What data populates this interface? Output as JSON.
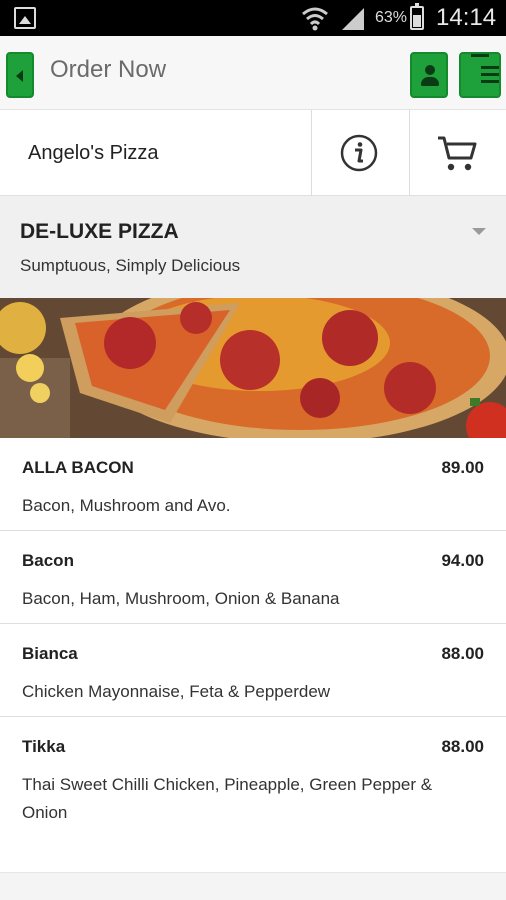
{
  "status_bar": {
    "battery_percent": "63%",
    "time": "14:14",
    "icons": [
      "gallery-icon",
      "wifi-icon",
      "signal-icon",
      "battery-icon"
    ]
  },
  "action_bar": {
    "title": "Order Now",
    "accent_color": "#1ea13a",
    "icons": [
      "back-arrow-icon",
      "user-icon",
      "menu-icon"
    ]
  },
  "shop": {
    "name": "Angelo's Pizza",
    "icons": [
      "info-icon",
      "cart-icon"
    ]
  },
  "category": {
    "title": "DE-LUXE PIZZA",
    "subtitle": "Sumptuous, Simply Delicious",
    "icon": "dropdown-caret-icon"
  },
  "menu_items": [
    {
      "name": "ALLA BACON",
      "price": "89.00",
      "description": "Bacon, Mushroom and Avo."
    },
    {
      "name": "Bacon",
      "price": "94.00",
      "description": "Bacon, Ham, Mushroom, Onion & Banana"
    },
    {
      "name": "Bianca",
      "price": "88.00",
      "description": "Chicken Mayonnaise, Feta & Pepperdew"
    },
    {
      "name": "Tikka",
      "price": "88.00",
      "description": "Thai Sweet Chilli Chicken, Pineapple, Green Pepper & Onion"
    }
  ]
}
